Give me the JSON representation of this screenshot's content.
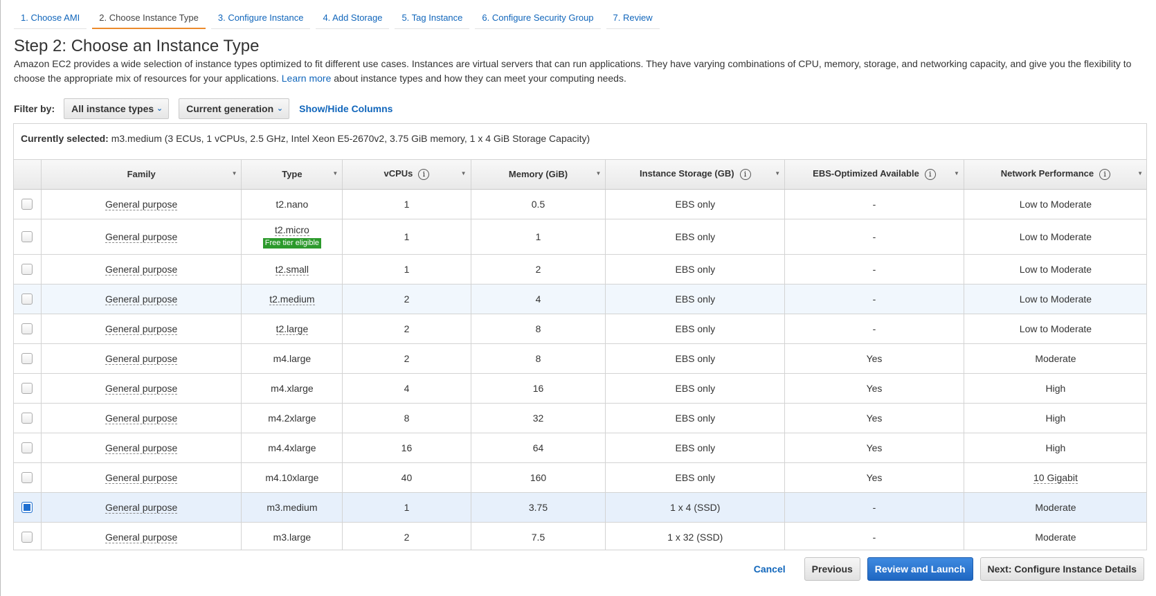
{
  "wizard": {
    "tabs": [
      {
        "label": "1. Choose AMI"
      },
      {
        "label": "2. Choose Instance Type"
      },
      {
        "label": "3. Configure Instance"
      },
      {
        "label": "4. Add Storage"
      },
      {
        "label": "5. Tag Instance"
      },
      {
        "label": "6. Configure Security Group"
      },
      {
        "label": "7. Review"
      }
    ],
    "active_index": 1
  },
  "page": {
    "title": "Step 2: Choose an Instance Type",
    "intro_before_link": "Amazon EC2 provides a wide selection of instance types optimized to fit different use cases. Instances are virtual servers that can run applications. They have varying combinations of CPU, memory, storage, and networking capacity, and give you the flexibility to choose the appropriate mix of resources for your applications.",
    "learn_more": "Learn more",
    "intro_after_link": "about instance types and how they can meet your computing needs."
  },
  "filter": {
    "label": "Filter by:",
    "instance_types": "All instance types",
    "generation": "Current generation",
    "show_hide": "Show/Hide Columns"
  },
  "selected": {
    "label": "Currently selected:",
    "value": "m3.medium (3 ECUs, 1 vCPUs, 2.5 GHz, Intel Xeon E5-2670v2, 3.75 GiB memory, 1 x 4 GiB Storage Capacity)"
  },
  "table": {
    "headers": [
      "Family",
      "Type",
      "vCPUs",
      "Memory (GiB)",
      "Instance Storage (GB)",
      "EBS-Optimized Available",
      "Network Performance"
    ],
    "free_tier_label": "Free tier eligible",
    "rows": [
      {
        "family": "General purpose",
        "type": "t2.nano",
        "vcpus": "1",
        "memory": "0.5",
        "storage": "EBS only",
        "ebs": "-",
        "network": "Low to Moderate",
        "checked": false
      },
      {
        "family": "General purpose",
        "type": "t2.micro",
        "vcpus": "1",
        "memory": "1",
        "storage": "EBS only",
        "ebs": "-",
        "network": "Low to Moderate",
        "checked": false
      },
      {
        "family": "General purpose",
        "type": "t2.small",
        "vcpus": "1",
        "memory": "2",
        "storage": "EBS only",
        "ebs": "-",
        "network": "Low to Moderate",
        "checked": false
      },
      {
        "family": "General purpose",
        "type": "t2.medium",
        "vcpus": "2",
        "memory": "4",
        "storage": "EBS only",
        "ebs": "-",
        "network": "Low to Moderate",
        "checked": false
      },
      {
        "family": "General purpose",
        "type": "t2.large",
        "vcpus": "2",
        "memory": "8",
        "storage": "EBS only",
        "ebs": "-",
        "network": "Low to Moderate",
        "checked": false
      },
      {
        "family": "General purpose",
        "type": "m4.large",
        "vcpus": "2",
        "memory": "8",
        "storage": "EBS only",
        "ebs": "Yes",
        "network": "Moderate",
        "checked": false
      },
      {
        "family": "General purpose",
        "type": "m4.xlarge",
        "vcpus": "4",
        "memory": "16",
        "storage": "EBS only",
        "ebs": "Yes",
        "network": "High",
        "checked": false
      },
      {
        "family": "General purpose",
        "type": "m4.2xlarge",
        "vcpus": "8",
        "memory": "32",
        "storage": "EBS only",
        "ebs": "Yes",
        "network": "High",
        "checked": false
      },
      {
        "family": "General purpose",
        "type": "m4.4xlarge",
        "vcpus": "16",
        "memory": "64",
        "storage": "EBS only",
        "ebs": "Yes",
        "network": "High",
        "checked": false
      },
      {
        "family": "General purpose",
        "type": "m4.10xlarge",
        "vcpus": "40",
        "memory": "160",
        "storage": "EBS only",
        "ebs": "Yes",
        "network": "10 Gigabit",
        "checked": false
      },
      {
        "family": "General purpose",
        "type": "m3.medium",
        "vcpus": "1",
        "memory": "3.75",
        "storage": "1 x 4 (SSD)",
        "ebs": "-",
        "network": "Moderate",
        "checked": true
      },
      {
        "family": "General purpose",
        "type": "m3.large",
        "vcpus": "2",
        "memory": "7.5",
        "storage": "1 x 32 (SSD)",
        "ebs": "-",
        "network": "Moderate",
        "checked": false
      }
    ]
  },
  "footer": {
    "cancel": "Cancel",
    "previous": "Previous",
    "review_launch": "Review and Launch",
    "next": "Next: Configure Instance Details"
  },
  "colors": {
    "link": "#1166bb",
    "active_tab_underline": "#ec8b2c",
    "primary_button": "#1f67c2",
    "free_tier_badge": "#2c9a2c",
    "selected_row": "#e7f0fb"
  }
}
